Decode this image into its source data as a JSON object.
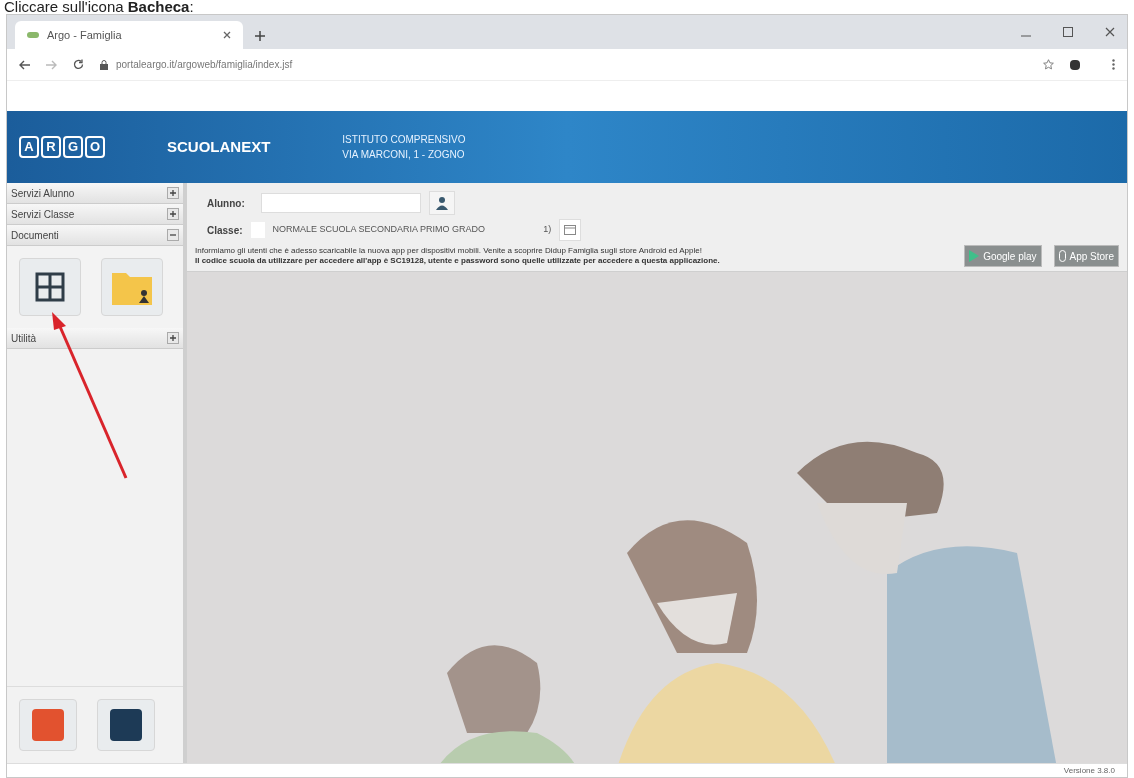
{
  "caption": "Cliccare sull'icona **Bacheca**:",
  "browser": {
    "tab_title": "Argo - Famiglia",
    "url": "portaleargo.it/argoweb/famiglia/index.jsf"
  },
  "header": {
    "logo_letters": [
      "A",
      "R",
      "G",
      "O"
    ],
    "product": "SCUOLANEXT",
    "school_lines": [
      "ISTITUTO COMPRENSIVO",
      "VIA MARCONI, 1 - ZOGNO"
    ]
  },
  "sidebar": {
    "sections": [
      {
        "label": "Servizi Alunno",
        "expanded": false
      },
      {
        "label": "Servizi Classe",
        "expanded": false
      },
      {
        "label": "Documenti",
        "expanded": true
      },
      {
        "label": "Utilità",
        "expanded": false
      }
    ]
  },
  "form": {
    "student_label": "Alunno:",
    "class_label": "Classe:",
    "class_value": "NORMALE SCUOLA SECONDARIA PRIMO GRADO",
    "calendar_label": "1)"
  },
  "notice": {
    "line": "Informiamo gli utenti che è adesso scaricabile la nuova app per dispositivi mobili. Venite a scoprire Didup Famiglia sugli store Android ed Apple!",
    "bold_line": "Il codice scuola da utilizzare per accedere all'app è SC19128, utente e password sono quelle utilizzate per accedere a questa applicazione."
  },
  "store_badges": [
    {
      "kind": "google",
      "label": "Google play"
    },
    {
      "kind": "apple",
      "label": "App Store"
    }
  ],
  "version": "Versione 3.8.0"
}
